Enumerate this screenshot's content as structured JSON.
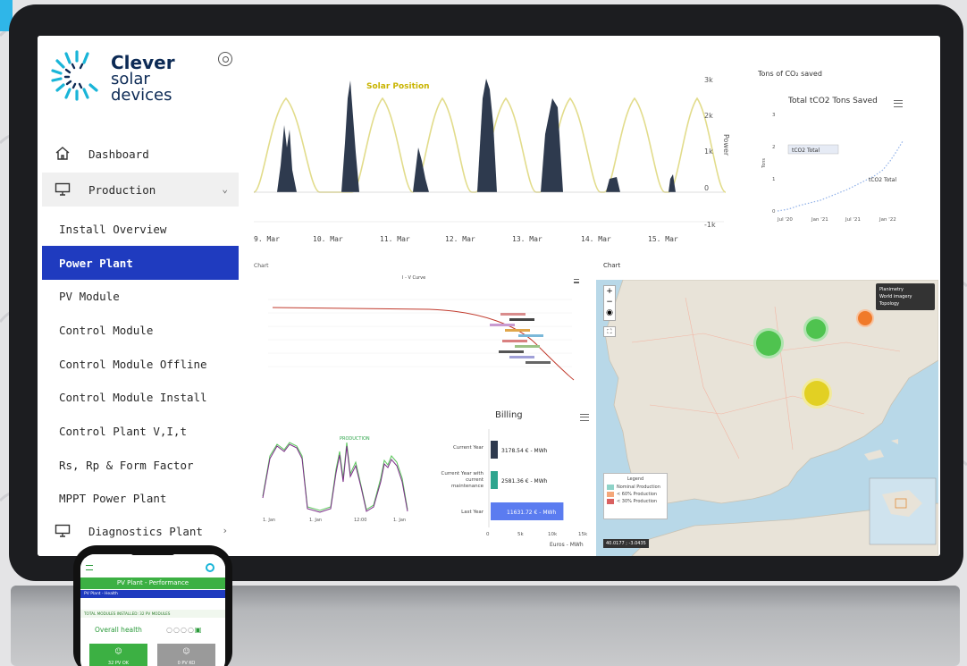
{
  "brand": {
    "line1": "Clever",
    "line2": "solar",
    "line3": "devices"
  },
  "sidebar": {
    "items": [
      {
        "label": "Dashboard"
      },
      {
        "label": "Production"
      },
      {
        "label": "Install Overview"
      },
      {
        "label": "Power Plant"
      },
      {
        "label": "PV Module"
      },
      {
        "label": "Control Module"
      },
      {
        "label": "Control Module Offline"
      },
      {
        "label": "Control Module Install"
      },
      {
        "label": "Control Plant V,I,t"
      },
      {
        "label": "Rs, Rp & Form Factor"
      },
      {
        "label": "MPPT Power Plant"
      },
      {
        "label": "Diagnostics Plant"
      }
    ]
  },
  "power_chart": {
    "series_label": "Solar Position",
    "ylabel": "Power",
    "y_ticks": [
      "3k",
      "2k",
      "1k",
      "0",
      "-1k"
    ],
    "x_ticks": [
      "9. Mar",
      "10. Mar",
      "11. Mar",
      "12. Mar",
      "13. Mar",
      "14. Mar",
      "15. Mar"
    ]
  },
  "co2": {
    "heading": "Tons of CO₂ saved",
    "title": "Total tCO2 Tons Saved",
    "legend": "tCO2 Total",
    "series_label": "tCO2 Total",
    "ylabel": "Tons",
    "y_ticks": [
      "3",
      "2",
      "1",
      "0"
    ],
    "x_ticks": [
      "Jul '20",
      "Jan '21",
      "Jul '21",
      "Jan '22"
    ]
  },
  "iv_chart": {
    "heading": "Chart",
    "title": "I - V Curve"
  },
  "billing": {
    "title": "Billing",
    "bars": [
      {
        "category": "Current Year",
        "label": "3178.54 € - MWh",
        "value": 3178.54,
        "color": "#2e3a4e"
      },
      {
        "category": "Current Year with current maintenance",
        "label": "2581.36 € - MWh",
        "value": 2581.36,
        "color": "#2ea58e"
      },
      {
        "category": "Last Year",
        "label": "11631.72 € - MWh",
        "value": 11631.72,
        "color": "#5b7cf0"
      }
    ],
    "x_ticks": [
      "0",
      "5k",
      "10k",
      "15k"
    ],
    "xlabel": "Euros - MWh"
  },
  "production_small": {
    "title": "PRODUCTION",
    "x_ticks": [
      "1. Jan",
      "1. Jan",
      "12:00",
      "1. Jan"
    ]
  },
  "map": {
    "heading": "Chart",
    "layers": [
      "Planimetry",
      "World imagery",
      "Topology"
    ],
    "legend_title": "Legend",
    "legend_items": [
      {
        "label": "Nominal Production",
        "color": "#8fd3c8"
      },
      {
        "label": "< 60% Production",
        "color": "#f4a77a"
      },
      {
        "label": "< 30% Production",
        "color": "#d96060"
      }
    ],
    "coords": "40.0177 ; -3.0435"
  },
  "phone": {
    "title": "PV Plant - Performance",
    "subtitle": "PV Plant - Health",
    "installed": "TOTAL MODULES INSTALLED: 32 PV MODULES",
    "health_label": "Overall health",
    "ok": "32 PV OK",
    "ko": "0 PV KO"
  }
}
